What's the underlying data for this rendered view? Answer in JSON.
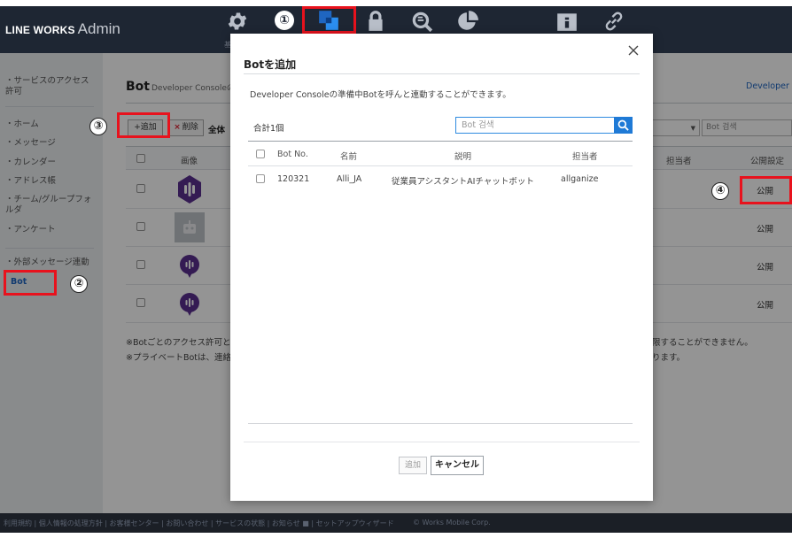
{
  "header": {
    "brand": "LINE WORKS",
    "product": "Admin",
    "icons": [
      "gear-icon",
      "services-icon",
      "lock-icon",
      "search-monitor-icon",
      "pie-chart-icon",
      "info-building-icon",
      "link-icon"
    ],
    "settings_sub": "基"
  },
  "sidebar": {
    "items": [
      "・サービスのアクセス許可",
      "・ホーム",
      "・メッセージ",
      "・カレンダー",
      "・アドレス帳",
      "・チーム/グループフォルダ",
      "・アンケート",
      "・外部メッセージ連動",
      "Bot"
    ]
  },
  "main": {
    "title": "Bot",
    "title_sub": "Developer Consoleの",
    "title_sub_cut": "B",
    "developer_link": "Developer Co",
    "add_button": "+追加",
    "delete_button": "削除",
    "delete_x": "×",
    "filter_all": "全体",
    "search_placeholder": "Bot 검색",
    "columns": {
      "image": "画像",
      "owner": "担当者",
      "publish": "公開設定"
    },
    "rows": [
      {
        "publish": "公開"
      },
      {
        "publish": "公開"
      },
      {
        "publish": "公開"
      },
      {
        "publish": "公開"
      }
    ],
    "notes": [
      "※Botごとのアクセス許可と公",
      "※プライベートBotは、連絡先",
      "限することができません。",
      "ります。"
    ]
  },
  "modal": {
    "title": "Botを追加",
    "description": "Developer Consoleの準備中Botを呼んと連動することができます。",
    "total": "合計1個",
    "search_placeholder": "Bot 검색",
    "columns": {
      "bot_no": "Bot No.",
      "name": "名前",
      "description": "説明",
      "owner": "担当者"
    },
    "row": {
      "bot_no": "120321",
      "name": "Alli_JA",
      "description": "従業員アシスタントAIチャットボット",
      "owner": "allganize"
    },
    "add_button": "追加",
    "cancel_button": "キャンセル"
  },
  "annotations": {
    "n1": "①",
    "n2": "②",
    "n3": "③",
    "n4": "④",
    "color": "#e8121d"
  },
  "footer": {
    "links": "利用規約 | 個人情報の処理方針 | お客様センター | お問い合わせ | サービスの状態 | お知らせ ■ | セットアップウィザード",
    "copyright": "© Works Mobile Corp."
  },
  "colors": {
    "header_bg": "#1e2633",
    "accent": "#1f7ad6",
    "bot_purple": "#5b2f8f"
  }
}
